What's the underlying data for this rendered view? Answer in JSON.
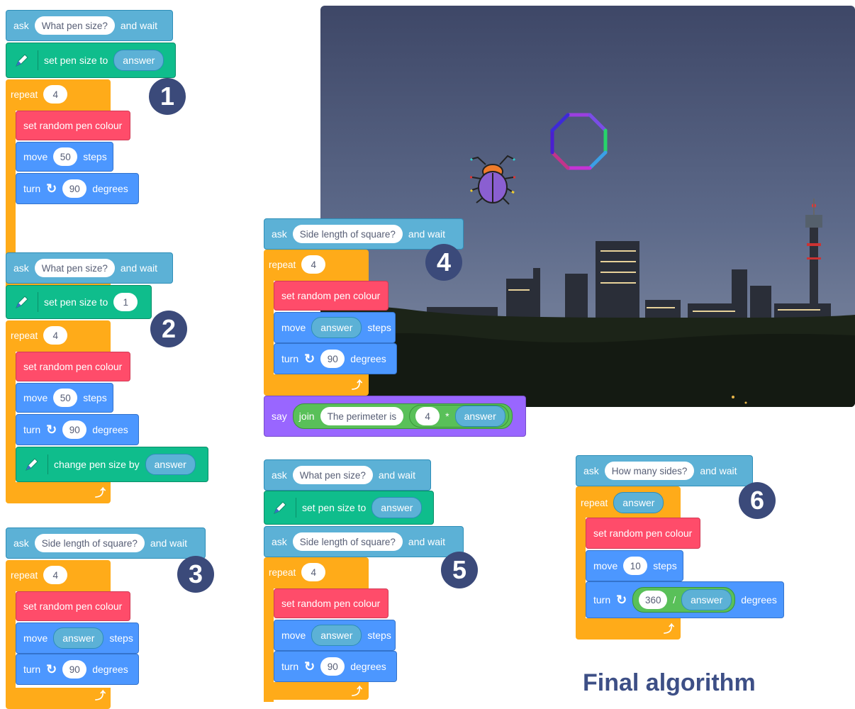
{
  "blocks": {
    "ask": "ask",
    "and_wait": "and wait",
    "set_pen_size_to": "set pen size to",
    "repeat": "repeat",
    "set_random_pen_colour": "set random pen colour",
    "move": "move",
    "steps": "steps",
    "turn": "turn",
    "degrees": "degrees",
    "change_pen_size_by": "change pen size by",
    "answer": "answer",
    "say": "say",
    "join": "join",
    "times": "*",
    "divide": "/"
  },
  "prompts": {
    "pen_size": "What pen size?",
    "side_length": "Side length of square?",
    "perimeter": "The perimeter is",
    "sides": "How many sides?"
  },
  "values": {
    "four": "4",
    "fifty": "50",
    "ninety": "90",
    "one": "1",
    "ten": "10",
    "three_sixty": "360"
  },
  "badges": [
    "1",
    "2",
    "3",
    "4",
    "5",
    "6"
  ],
  "title": "Final algorithm",
  "colors": {
    "sensing": "#5cb1d6",
    "pen": "#0fbd8c",
    "control": "#ffab19",
    "pen_colour": "#ff4c6a",
    "motion": "#4c97ff",
    "looks": "#9966ff",
    "badge": "#3b4a7a"
  }
}
